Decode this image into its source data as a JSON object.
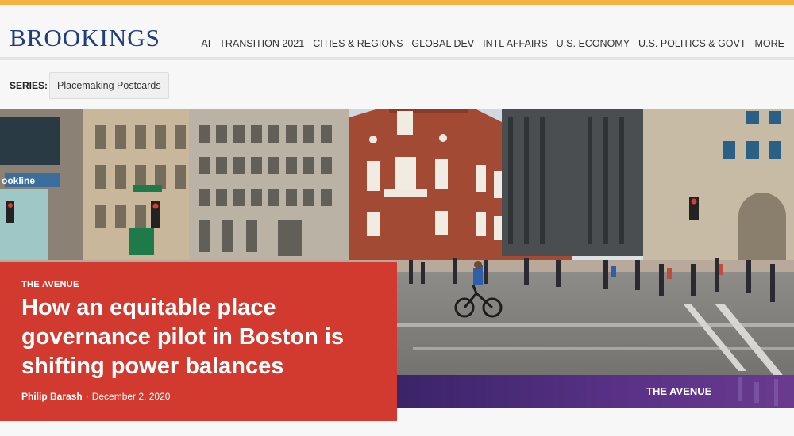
{
  "brand": {
    "logo": "BROOKINGS"
  },
  "nav": {
    "items": [
      "AI",
      "TRANSITION 2021",
      "CITIES & REGIONS",
      "GLOBAL DEV",
      "INTL AFFAIRS",
      "U.S. ECONOMY",
      "U.S. POLITICS & GOVT",
      "MORE"
    ]
  },
  "series": {
    "label": "SERIES:",
    "name": "Placemaking Postcards"
  },
  "hero": {
    "banner_text": "THE AVENUE",
    "sign_text": "ookline",
    "colors": {
      "brick": "#a34a34",
      "banner": "#4b2f7a",
      "card": "#d23a2f",
      "accent": "#f4b13f"
    }
  },
  "article": {
    "kicker": "THE AVENUE",
    "title": "How an equitable place governance pilot in Boston is shifting power balances",
    "author": "Philip Barash",
    "separator": "·",
    "date": "December 2, 2020"
  }
}
